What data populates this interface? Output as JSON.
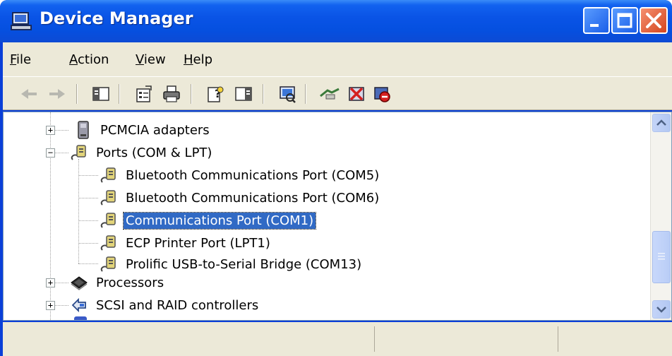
{
  "window": {
    "title": "Device Manager"
  },
  "menu": {
    "items": [
      {
        "label": "File",
        "underline": "F",
        "rest": "ile"
      },
      {
        "label": "Action",
        "underline": "A",
        "rest": "ction"
      },
      {
        "label": "View",
        "underline": "V",
        "rest": "iew"
      },
      {
        "label": "Help",
        "underline": "H",
        "rest": "elp"
      }
    ]
  },
  "toolbar": {
    "icons": [
      "back-arrow-icon",
      "forward-arrow-icon",
      "show-hide-console-tree-icon",
      "properties-icon",
      "print-icon",
      "help-icon",
      "show-hide-action-pane-icon",
      "scan-hardware-icon",
      "update-driver-icon",
      "uninstall-icon",
      "disable-icon"
    ]
  },
  "tree": {
    "items": [
      {
        "label": "PCMCIA adapters",
        "level": 0,
        "expander": "+",
        "icon": "pcmcia-icon"
      },
      {
        "label": "Ports (COM & LPT)",
        "level": 0,
        "expander": "−",
        "icon": "port-icon"
      },
      {
        "label": "Bluetooth Communications Port (COM5)",
        "level": 1,
        "icon": "port-icon"
      },
      {
        "label": "Bluetooth Communications Port (COM6)",
        "level": 1,
        "icon": "port-icon"
      },
      {
        "label": "Communications Port (COM1)",
        "level": 1,
        "icon": "port-icon",
        "selected": true
      },
      {
        "label": "ECP Printer Port (LPT1)",
        "level": 1,
        "icon": "port-icon"
      },
      {
        "label": "Prolific USB-to-Serial Bridge (COM13)",
        "level": 1,
        "icon": "port-icon"
      },
      {
        "label": "Processors",
        "level": 0,
        "expander": "+",
        "icon": "processor-icon"
      },
      {
        "label": "SCSI and RAID controllers",
        "level": 0,
        "expander": "+",
        "icon": "scsi-icon"
      }
    ]
  },
  "colors": {
    "selection": "#316ac5",
    "titlebar": "#0a54e6",
    "chrome": "#ece9d8"
  }
}
